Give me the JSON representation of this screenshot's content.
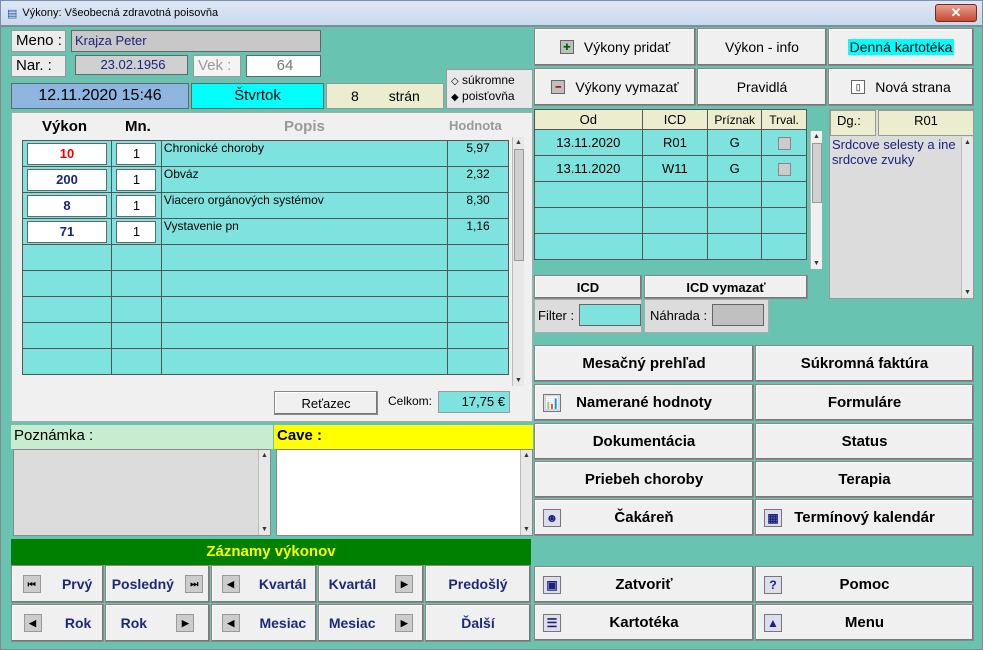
{
  "window": {
    "title": "Výkony: Všeobecná zdravotná poisovňa",
    "close_glyph": "✕"
  },
  "patient": {
    "name_label": "Meno :",
    "name": "Krajza Peter",
    "dob_label": "Nar. :",
    "dob": "23.02.1956",
    "age_label": "Vek :",
    "age": "64"
  },
  "infobar": {
    "datetime": "12.11.2020 15:46",
    "weekday": "Štvrtok",
    "pages": "8",
    "pages_label": "strán"
  },
  "insurance": {
    "options": [
      "súkromne",
      "poisťovňa"
    ],
    "selected": "poisťovňa"
  },
  "vykony": {
    "headers": [
      "Výkon",
      "Mn.",
      "Popis",
      "Hodnota"
    ],
    "rows": [
      {
        "code": "10",
        "qty": "1",
        "desc": "Chronické choroby",
        "value": "5,97"
      },
      {
        "code": "200",
        "qty": "1",
        "desc": "Obváz",
        "value": "2,32"
      },
      {
        "code": "8",
        "qty": "1",
        "desc": "Viacero orgánových systémov",
        "value": "8,30"
      },
      {
        "code": "71",
        "qty": "1",
        "desc": "Vystavenie pn",
        "value": "1,16"
      }
    ],
    "retazec": "Reťazec",
    "celkom_label": "Celkom:",
    "celkom": "17,75 €"
  },
  "notes": {
    "poznamka": "Poznámka :",
    "cave": "Cave :"
  },
  "records": {
    "title": "Záznamy výkonov",
    "nav": [
      "Prvý",
      "Posledný",
      "Kvartál",
      "Kvartál",
      "Predošlý",
      "Rok",
      "Rok",
      "Mesiac",
      "Mesiac",
      "Ďalší"
    ]
  },
  "top_buttons": {
    "pridat": "Výkony pridať",
    "info": "Výkon - info",
    "kartoteka": "Denná kartotéka",
    "vymazat": "Výkony vymazať",
    "pravidla": "Pravidlá",
    "nova": "Nová strana"
  },
  "diag": {
    "headers": [
      "Od",
      "ICD",
      "Príznak",
      "Trval."
    ],
    "rows": [
      {
        "od": "13.11.2020",
        "icd": "R01",
        "priznak": "G"
      },
      {
        "od": "13.11.2020",
        "icd": "W11",
        "priznak": "G"
      }
    ],
    "dg_label": "Dg.:",
    "dg": "R01",
    "dg_text": "Srdcove selesty a ine srdcove zvuky",
    "icd_btn": "ICD",
    "icd_del": "ICD vymazať",
    "filter": "Filter :",
    "nahrada": "Náhrada :"
  },
  "menu": {
    "mesacny": "Mesačný prehľad",
    "faktura": "Súkromná faktúra",
    "namerane": "Namerané hodnoty",
    "formulare": "Formuláre",
    "dokumentacia": "Dokumentácia",
    "status": "Status",
    "priebeh": "Priebeh choroby",
    "terapia": "Terapia",
    "cakaren": "Čakáreň",
    "kalendar": "Termínový kalendár",
    "zatvorit": "Zatvoriť",
    "pomoc": "Pomoc",
    "kartoteka": "Kartotéka",
    "menu": "Menu"
  },
  "colors": {
    "bg": "#69c3b1",
    "cyan": "#7ee3df",
    "yellow": "#ffff00",
    "green": "#008000"
  }
}
